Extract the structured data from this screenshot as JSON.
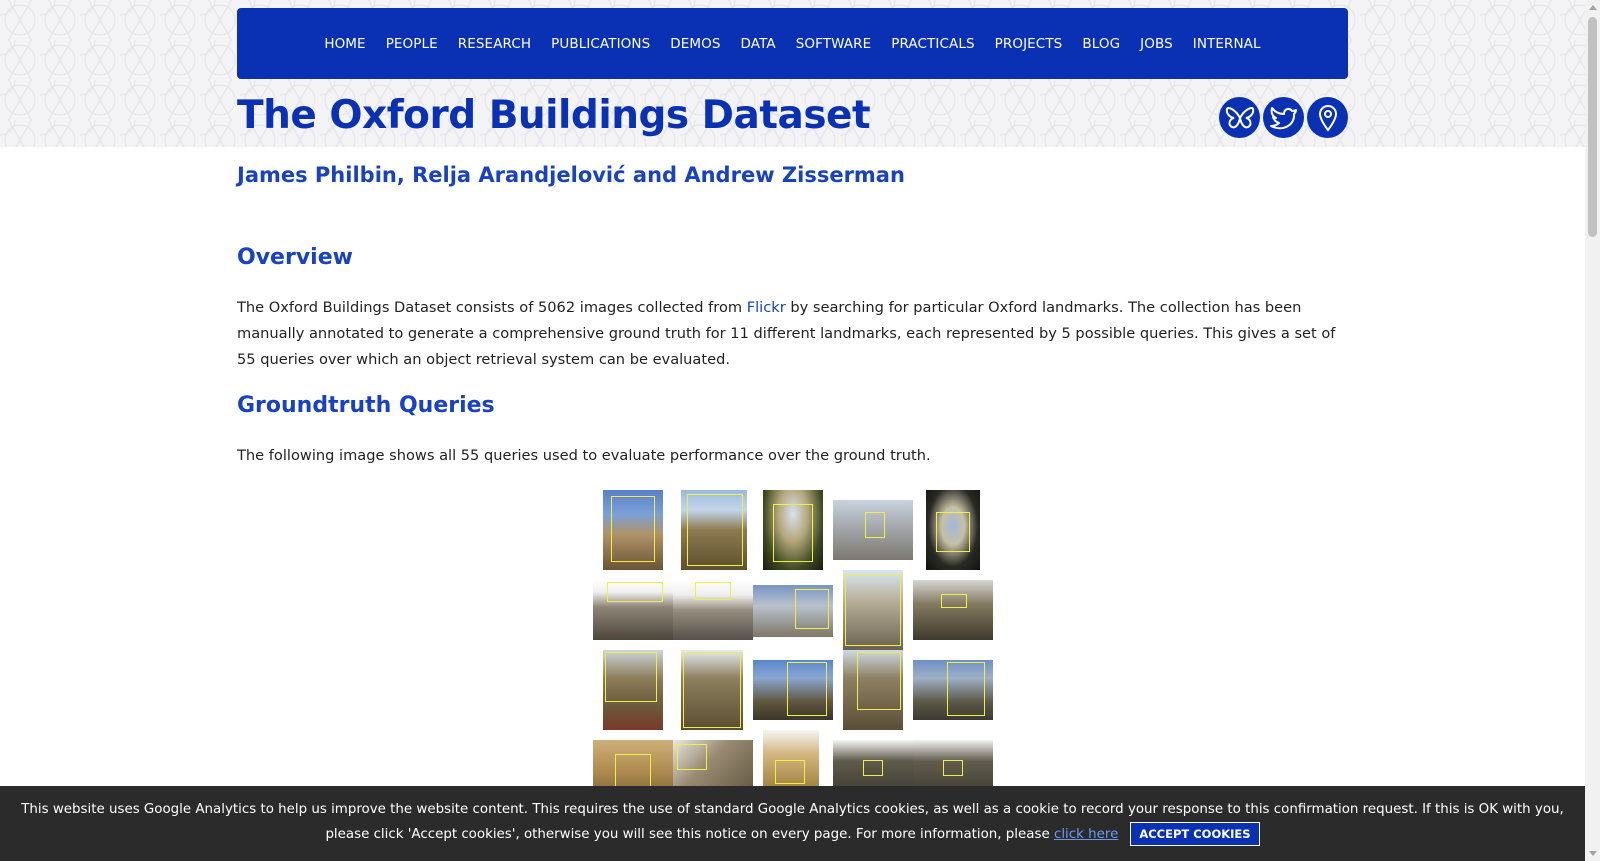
{
  "nav": {
    "items": [
      "HOME",
      "PEOPLE",
      "RESEARCH",
      "PUBLICATIONS",
      "DEMOS",
      "DATA",
      "SOFTWARE",
      "PRACTICALS",
      "PROJECTS",
      "BLOG",
      "JOBS",
      "INTERNAL"
    ]
  },
  "page": {
    "title": "The Oxford Buildings Dataset",
    "authors": "James Philbin, Relja Arandjelović and Andrew Zisserman"
  },
  "social": {
    "icons": [
      "butterfly-icon",
      "twitter-bird-icon",
      "map-pin-icon"
    ]
  },
  "overview": {
    "heading": "Overview",
    "text_before_link": "The Oxford Buildings Dataset consists of 5062 images collected from ",
    "link": "Flickr",
    "text_after_link": " by searching for particular Oxford landmarks. The collection has been manually annotated to generate a comprehensive ground truth for 11 different landmarks, each represented by 5 possible queries. This gives a set of 55 queries over which an object retrieval system can be evaluated."
  },
  "groundtruth": {
    "heading": "Groundtruth Queries",
    "text": "The following image shows all 55 queries used to evaluate performance over the ground truth."
  },
  "cookie": {
    "text_before_link": "This website uses Google Analytics to help us improve the website content. This requires the use of standard Google Analytics cookies, as well as a cookie to record your response to this confirmation request. If this is OK with you, please click 'Accept cookies', otherwise you will see this notice on every page. For more information, please ",
    "link": "click here",
    "button": "ACCEPT COOKIES"
  },
  "colors": {
    "brand": "#0a31b4",
    "heading": "#1841c4",
    "query_box": "#f0f044"
  }
}
